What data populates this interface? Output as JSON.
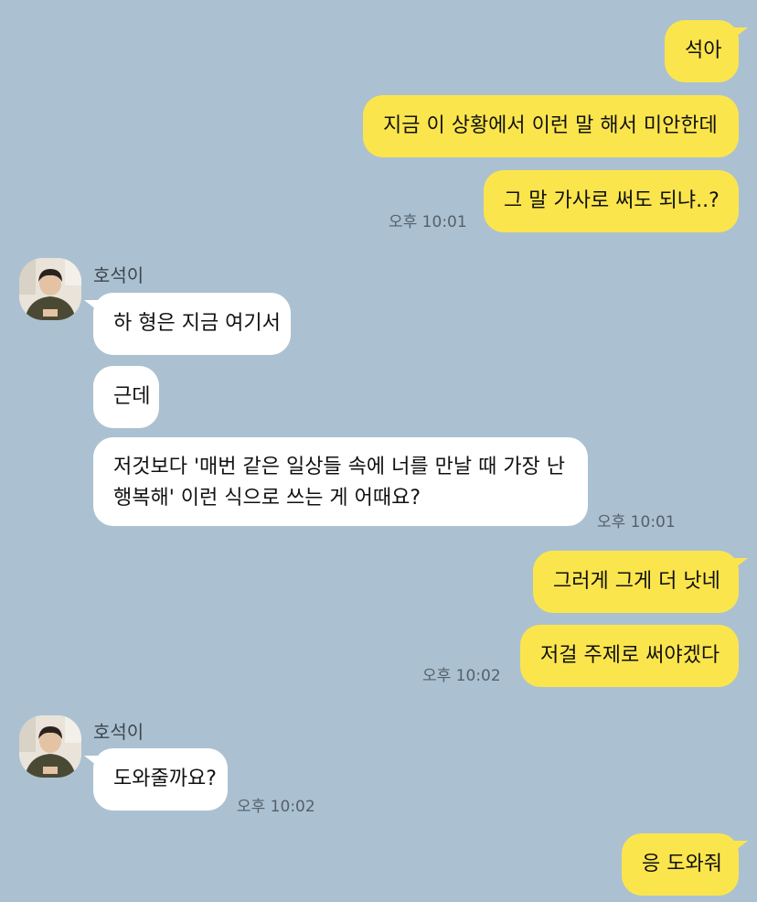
{
  "messages_me_1": {
    "m1": "석아",
    "m2": "지금 이 상황에서 이런 말 해서 미안한데",
    "m3": "그 말 가사로 써도 되냐..?",
    "time": "오후 10:01"
  },
  "group_other_1": {
    "sender": "호석이",
    "m1": "하 형은 지금 여기서",
    "m2": "근데",
    "m3_line1": "저것보다 '매번 같은 일상들 속에 너를 만날 때 가장 난",
    "m3_line2": "행복해' 이런 식으로 쓰는 게 어때요?",
    "time": "오후 10:01"
  },
  "messages_me_2": {
    "m1": "그러게 그게 더 낫네",
    "m2": "저걸 주제로 써야겠다",
    "time": "오후 10:02"
  },
  "group_other_2": {
    "sender": "호석이",
    "m1": "도와줄까요?",
    "time": "오후 10:02"
  },
  "messages_me_3": {
    "m1": "응 도와줘"
  },
  "colors": {
    "background": "#abc1d1",
    "my_bubble": "#fbe54d",
    "other_bubble": "#ffffff"
  },
  "icons": {
    "avatar": "profile-photo"
  }
}
